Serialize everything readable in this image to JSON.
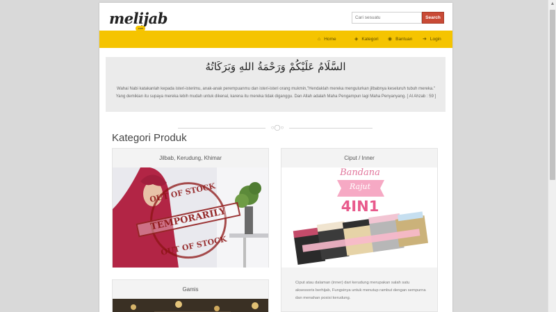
{
  "header": {
    "logo_text": "melijab",
    "logo_suffix": ".com",
    "search_placeholder": "Cari sesuatu",
    "search_button": "Search"
  },
  "nav": {
    "items": [
      {
        "label": "Home",
        "icon": "home-icon"
      },
      {
        "label": "Kategori",
        "icon": "tags-icon"
      },
      {
        "label": "Bantuan",
        "icon": "help-icon"
      },
      {
        "label": "Login",
        "icon": "login-icon"
      }
    ]
  },
  "greeting": {
    "arabic": "السَّلَامُ عَلَيْكُمْ وَرَحْمَةُ اللهِ وَبَرَكَاتُهُ",
    "verse": "Wahai Nabi katakanlah kepada isteri-isterimu, anak-anak perempuanmu dan isteri-isteri orang mukmin,\"Hendaklah mereka mengulurkan jilbabnya keseluruh tubuh mereka.\" Yang demikian itu supaya mereka lebih mudah untuk dikenal, karena itu mereka tidak diganggu. Dan Allah adalah Maha Pengampun lagi Maha Penyanyang. [ Al Ahzab : 59 ]"
  },
  "section_title": "Kategori Produk",
  "categories": [
    {
      "title": "Jilbab, Kerudung, Khimar",
      "stamp_top": "OUT OF STOCK",
      "stamp_mid": "TEMPORARILY",
      "stamp_bottom": "OUT OF STOCK"
    },
    {
      "title": "Ciput / Inner",
      "image_line1": "Bandana",
      "image_line2": "Rajut",
      "image_line3": "4IN1",
      "description": "Ciput atau dalaman (inner) dari kerudung merupakan salah satu aksessoris berhijab, Fungsinya untuk menutup rambut dengan sempurna dan menahan posisi kerudung."
    },
    {
      "title": "Gamis"
    }
  ]
}
